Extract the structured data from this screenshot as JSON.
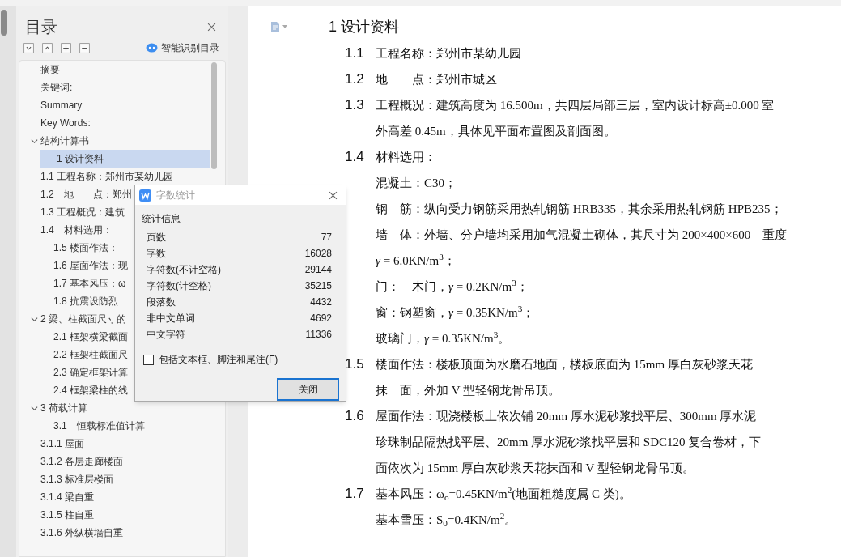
{
  "sidebar": {
    "title": "目录",
    "smart_button": "智能识别目录",
    "toc": [
      {
        "label": "摘要",
        "selected": false
      },
      {
        "label": "关键词:",
        "selected": false
      },
      {
        "label": "Summary",
        "selected": false
      },
      {
        "label": "Key Words:",
        "selected": false
      },
      {
        "label": "结构计算书",
        "selected": false,
        "expanded": true,
        "children": [
          {
            "label": "1 设计资料",
            "selected": true
          }
        ]
      },
      {
        "label": "1.1  工程名称：郑州市某幼儿园",
        "selected": false
      },
      {
        "label": "1.2　地　　点：郑州",
        "selected": false
      },
      {
        "label": "1.3  工程概况：建筑",
        "selected": false
      },
      {
        "label": "1.4　材料选用：",
        "selected": false,
        "children": [
          {
            "label": "1.5  楼面作法：",
            "selected": false
          },
          {
            "label": "1.6  屋面作法：现",
            "selected": false
          },
          {
            "label": "1.7  基本风压：ω",
            "selected": false
          },
          {
            "label": "1.8  抗震设防烈",
            "selected": false
          }
        ]
      },
      {
        "label": "2  梁、柱截面尺寸的",
        "selected": false,
        "expanded": true,
        "children": [
          {
            "label": "2.1  框架横梁截面",
            "selected": false
          },
          {
            "label": "2.2  框架柱截面尺",
            "selected": false
          },
          {
            "label": "2.3  确定框架计算",
            "selected": false
          },
          {
            "label": "2.4  框架梁柱的线",
            "selected": false
          }
        ]
      },
      {
        "label": "3  荷载计算",
        "selected": false,
        "expanded": true,
        "children": [
          {
            "label": "3.1　恒载标准值计算",
            "selected": false
          }
        ]
      },
      {
        "label": "3.1.1  屋面",
        "selected": false
      },
      {
        "label": "3.1.2  各层走廊楼面",
        "selected": false
      },
      {
        "label": "3.1.3  标准层楼面",
        "selected": false
      },
      {
        "label": "3.1.4  梁自重",
        "selected": false
      },
      {
        "label": "3.1.5  柱自重",
        "selected": false
      },
      {
        "label": "3.1.6  外纵横墙自重",
        "selected": false
      }
    ]
  },
  "dialog": {
    "title": "字数统计",
    "section": "统计信息",
    "stats": [
      {
        "label": "页数",
        "value": "77"
      },
      {
        "label": "字数",
        "value": "16028"
      },
      {
        "label": "字符数(不计空格)",
        "value": "29144"
      },
      {
        "label": "字符数(计空格)",
        "value": "35215"
      },
      {
        "label": "段落数",
        "value": "4432"
      },
      {
        "label": "非中文单词",
        "value": "4692"
      },
      {
        "label": "中文字符",
        "value": "11336"
      }
    ],
    "include_option": {
      "label": "包括文本框、脚注和尾注(F)",
      "checked": false
    },
    "close_button": "关闭"
  },
  "document": {
    "heading": "1 设计资料",
    "blocks": [
      {
        "num": "1.1",
        "lines": [
          "工程名称：郑州市某幼儿园"
        ]
      },
      {
        "num": "1.2",
        "lines": [
          "地　　点：郑州市城区"
        ]
      },
      {
        "num": "1.3",
        "lines": [
          "工程概况：建筑高度为 16.500m，共四层局部三层，室内设计标高±0.000 室",
          "外高差 0.45m，具体见平面布置图及剖面图。"
        ]
      },
      {
        "num": "1.4",
        "lines": [
          "材料选用："
        ]
      },
      {
        "lines": [
          "混凝土：C30；",
          "钢　筋：纵向受力钢筋采用热轧钢筋 HRB335，其余采用热轧钢筋 HPB235；",
          "墙　体：外墙、分户墙均采用加气混凝土砌体，其尺寸为 200×400×600　重度",
          "*γ* = 6.0KN/m$^{3}$；",
          "门：　木门，*γ* = 0.2KN/m$^{3}$；",
          "窗：钢塑窗，*γ* = 0.35KN/m$^{3}$；",
          "玻璃门，*γ* = 0.35KN/m$^{3}$。"
        ]
      },
      {
        "num": "1.5",
        "lines": [
          "楼面作法：楼板顶面为水磨石地面，楼板底面为 15mm 厚白灰砂浆天花",
          "抹　面，外加 V 型轻钢龙骨吊顶。"
        ]
      },
      {
        "num": "1.6",
        "lines": [
          "屋面作法：现浇楼板上依次铺 20mm 厚水泥砂浆找平层、300mm 厚水泥",
          "珍珠制品隔热找平层、20mm 厚水泥砂浆找平层和 SDC120 复合卷材，下",
          "面依次为 15mm 厚白灰砂浆天花抹面和 V 型轻钢龙骨吊顶。"
        ]
      },
      {
        "num": "1.7",
        "lines": [
          "基本风压：ω$_{o}$=0.45KN/m$^{2}$(地面粗糙度属 C 类)。",
          "基本雪压：S$_{0}$=0.4KN/m$^{2}$。"
        ]
      }
    ]
  }
}
